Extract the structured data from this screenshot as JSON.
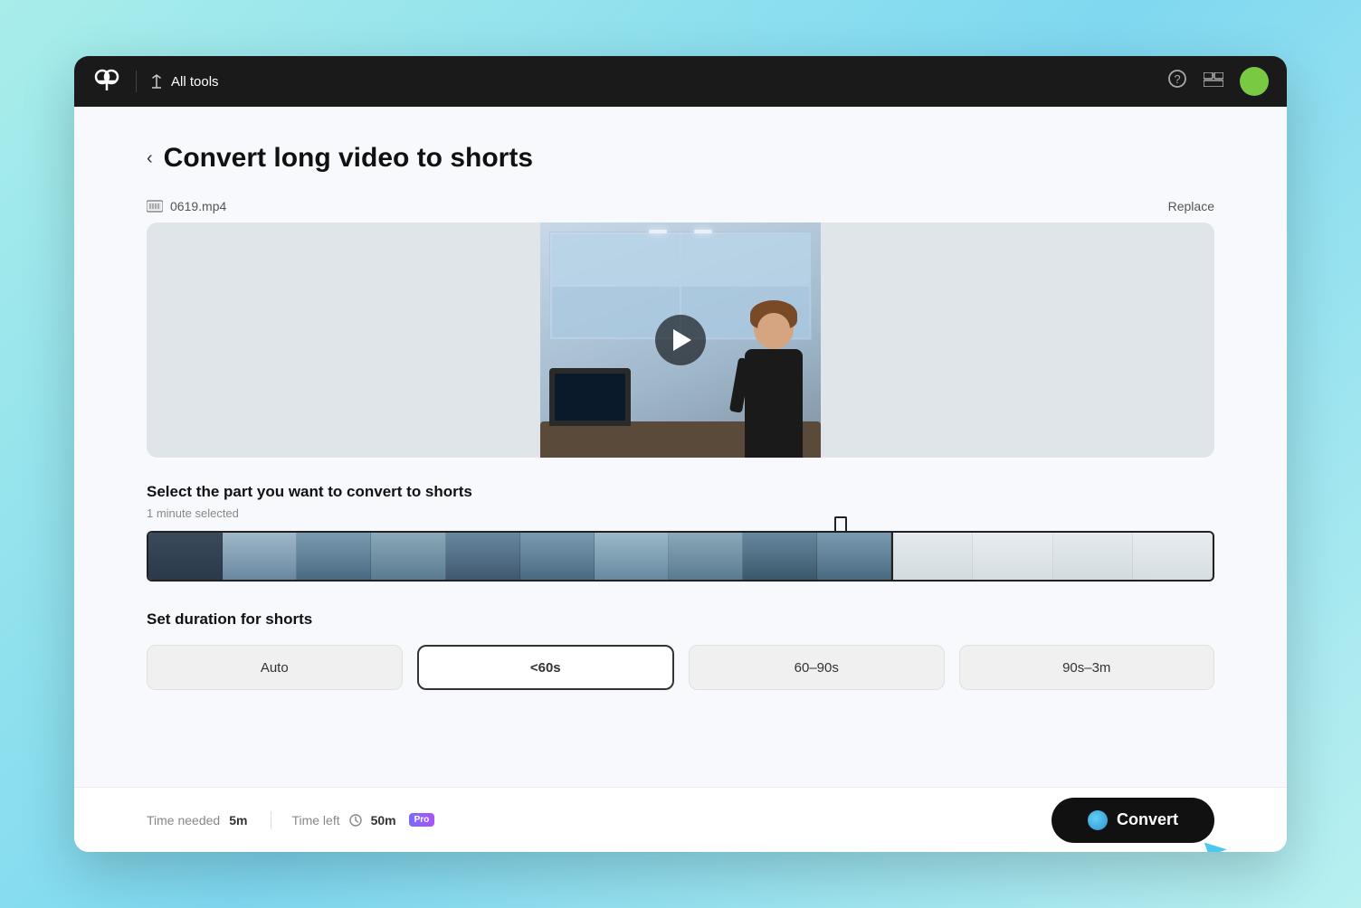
{
  "app": {
    "title": "CapCut"
  },
  "topbar": {
    "all_tools_label": "All tools",
    "help_icon": "?",
    "layout_icon": "≡"
  },
  "page": {
    "back_label": "‹",
    "title": "Convert long video to shorts",
    "file_name": "0619.mp4",
    "replace_label": "Replace"
  },
  "timeline": {
    "selection_label": "1 minute selected",
    "section_title": "Select the part you want to convert to shorts"
  },
  "duration": {
    "section_title": "Set duration for shorts",
    "options": [
      {
        "label": "Auto",
        "active": false
      },
      {
        "label": "<60s",
        "active": true
      },
      {
        "label": "60–90s",
        "active": false
      },
      {
        "label": "90s–3m",
        "active": false
      }
    ]
  },
  "footer": {
    "time_needed_label": "Time needed",
    "time_needed_value": "5m",
    "time_left_label": "Time left",
    "time_left_value": "50m",
    "pro_badge": "Pro",
    "convert_label": "Convert"
  }
}
